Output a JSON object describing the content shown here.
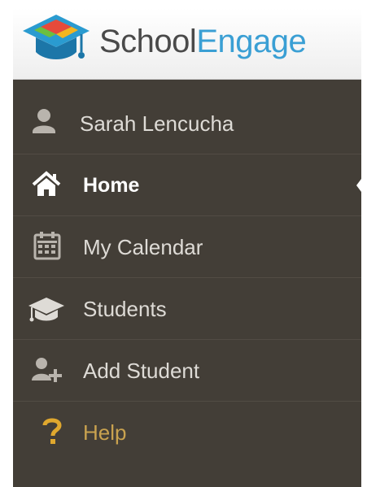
{
  "brand": {
    "name_part_a": "School",
    "name_part_b": "Engage",
    "logo_icon": "graduation-cap-logo-icon"
  },
  "colors": {
    "header_bg": "#f4f4f4",
    "menu_bg": "#433e37",
    "menu_text": "#dedbd6",
    "active_text": "#ffffff",
    "help_text": "#c9a24f",
    "brand_dark": "#4a4a4a",
    "brand_accent": "#3a9fd4"
  },
  "menu": {
    "active_item": "Home",
    "items": [
      {
        "label": "Sarah Lencucha",
        "icon": "user-icon"
      },
      {
        "label": "Home",
        "icon": "home-icon"
      },
      {
        "label": "My Calendar",
        "icon": "calendar-icon"
      },
      {
        "label": "Students",
        "icon": "graduation-cap-icon"
      },
      {
        "label": "Add Student",
        "icon": "add-user-icon"
      },
      {
        "label": "Help",
        "icon": "question-icon"
      }
    ]
  }
}
